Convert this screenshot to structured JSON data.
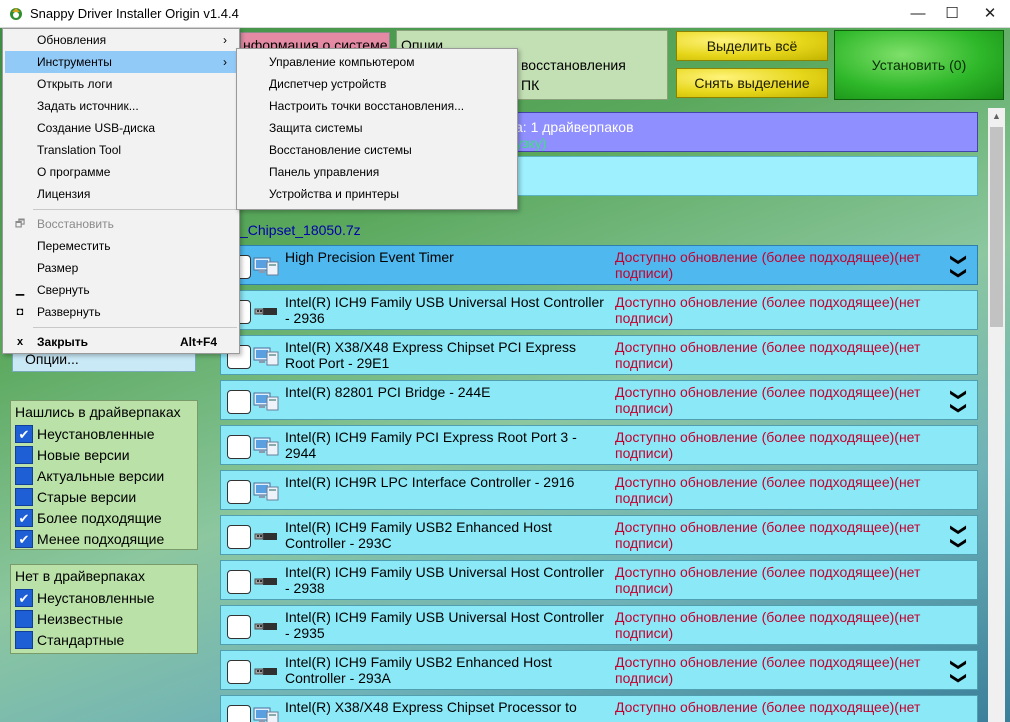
{
  "window": {
    "title": "Snappy Driver Installer Origin v1.4.4",
    "minimize": "—",
    "maximize": "☐",
    "close": "✕"
  },
  "top": {
    "info_tab": "нформация о системе",
    "options_title": "Опции",
    "options_line2": "восстановления",
    "options_line3": "ПК",
    "select_all": "Выделить всё",
    "deselect": "Снять выделение",
    "install": "Установить (0)"
  },
  "banners": {
    "banner1_line1": "а: 1 драйверпаков",
    "banner1_line2": "узку)",
    "pack_name": "_Chipset_18050.7z"
  },
  "drivers": [
    {
      "name": "High Precision Event Timer",
      "status": "Доступно обновление (более подходящее)(нет подписи)",
      "icon": "monitor-icon",
      "expand": true,
      "selected": true
    },
    {
      "name": "Intel(R) ICH9 Family USB Universal Host Controller - 2936",
      "status": "Доступно обновление (более подходящее)(нет подписи)",
      "icon": "usb-icon",
      "expand": false,
      "selected": false
    },
    {
      "name": "Intel(R) X38/X48 Express Chipset PCI Express Root Port - 29E1",
      "status": "Доступно обновление (более подходящее)(нет подписи)",
      "icon": "monitor-icon",
      "expand": false,
      "selected": false
    },
    {
      "name": "Intel(R) 82801 PCI Bridge - 244E",
      "status": "Доступно обновление (более подходящее)(нет подписи)",
      "icon": "monitor-icon",
      "expand": true,
      "selected": false
    },
    {
      "name": "Intel(R) ICH9 Family PCI Express Root Port 3 - 2944",
      "status": "Доступно обновление (более подходящее)(нет подписи)",
      "icon": "monitor-icon",
      "expand": false,
      "selected": false
    },
    {
      "name": "Intel(R) ICH9R LPC Interface Controller - 2916",
      "status": "Доступно обновление (более подходящее)(нет подписи)",
      "icon": "monitor-icon",
      "expand": false,
      "selected": false
    },
    {
      "name": "Intel(R) ICH9 Family USB2 Enhanced Host Controller - 293C",
      "status": "Доступно обновление (более подходящее)(нет подписи)",
      "icon": "usb-icon",
      "expand": true,
      "selected": false
    },
    {
      "name": "Intel(R) ICH9 Family USB Universal Host Controller - 2938",
      "status": "Доступно обновление (более подходящее)(нет подписи)",
      "icon": "usb-icon",
      "expand": false,
      "selected": false
    },
    {
      "name": "Intel(R) ICH9 Family USB Universal Host Controller - 2935",
      "status": "Доступно обновление (более подходящее)(нет подписи)",
      "icon": "usb-icon",
      "expand": false,
      "selected": false
    },
    {
      "name": "Intel(R) ICH9 Family USB2 Enhanced Host Controller - 293A",
      "status": "Доступно обновление (более подходящее)(нет подписи)",
      "icon": "usb-icon",
      "expand": true,
      "selected": false
    },
    {
      "name": "Intel(R) X38/X48 Express Chipset Processor to",
      "status": "Доступно обновление (более подходящее)(нет",
      "icon": "monitor-icon",
      "expand": false,
      "selected": false
    }
  ],
  "left": {
    "options_button": "Опции...",
    "found_title": "Нашлись в драйверпаках",
    "found_items": [
      {
        "label": "Неустановленные",
        "checked": true
      },
      {
        "label": "Новые версии",
        "checked": false
      },
      {
        "label": "Актуальные версии",
        "checked": false
      },
      {
        "label": "Старые версии",
        "checked": false
      },
      {
        "label": "Более подходящие",
        "checked": true
      },
      {
        "label": "Менее подходящие",
        "checked": true
      }
    ],
    "notfound_title": "Нет в драйверпаках",
    "notfound_items": [
      {
        "label": "Неустановленные",
        "checked": true
      },
      {
        "label": "Неизвестные",
        "checked": false
      },
      {
        "label": "Стандартные",
        "checked": false
      }
    ]
  },
  "main_menu": {
    "items": [
      {
        "label": "Обновления",
        "submenu": true
      },
      {
        "label": "Инструменты",
        "submenu": true
      },
      {
        "label": "Открыть логи"
      },
      {
        "label": "Задать источник..."
      },
      {
        "label": "Создание USB-диска"
      },
      {
        "label": "Translation Tool"
      },
      {
        "label": "О программе"
      },
      {
        "label": "Лицензия"
      }
    ],
    "system_items": [
      {
        "label": "Восстановить",
        "glyph": "🗗",
        "disabled": true
      },
      {
        "label": "Переместить",
        "glyph": ""
      },
      {
        "label": "Размер",
        "glyph": ""
      },
      {
        "label": "Свернуть",
        "glyph": "▁"
      },
      {
        "label": "Развернуть",
        "glyph": "◘"
      }
    ],
    "close_item": {
      "label": "Закрыть",
      "shortcut": "Alt+F4",
      "glyph": "x"
    }
  },
  "sub_menu": {
    "items": [
      "Управление компьютером",
      "Диспетчер устройств",
      "Настроить точки восстановления...",
      "Защита системы",
      "Восстановление системы",
      "Панель управления",
      "Устройства и принтеры"
    ]
  },
  "icons": {
    "expand": "❯❯"
  }
}
